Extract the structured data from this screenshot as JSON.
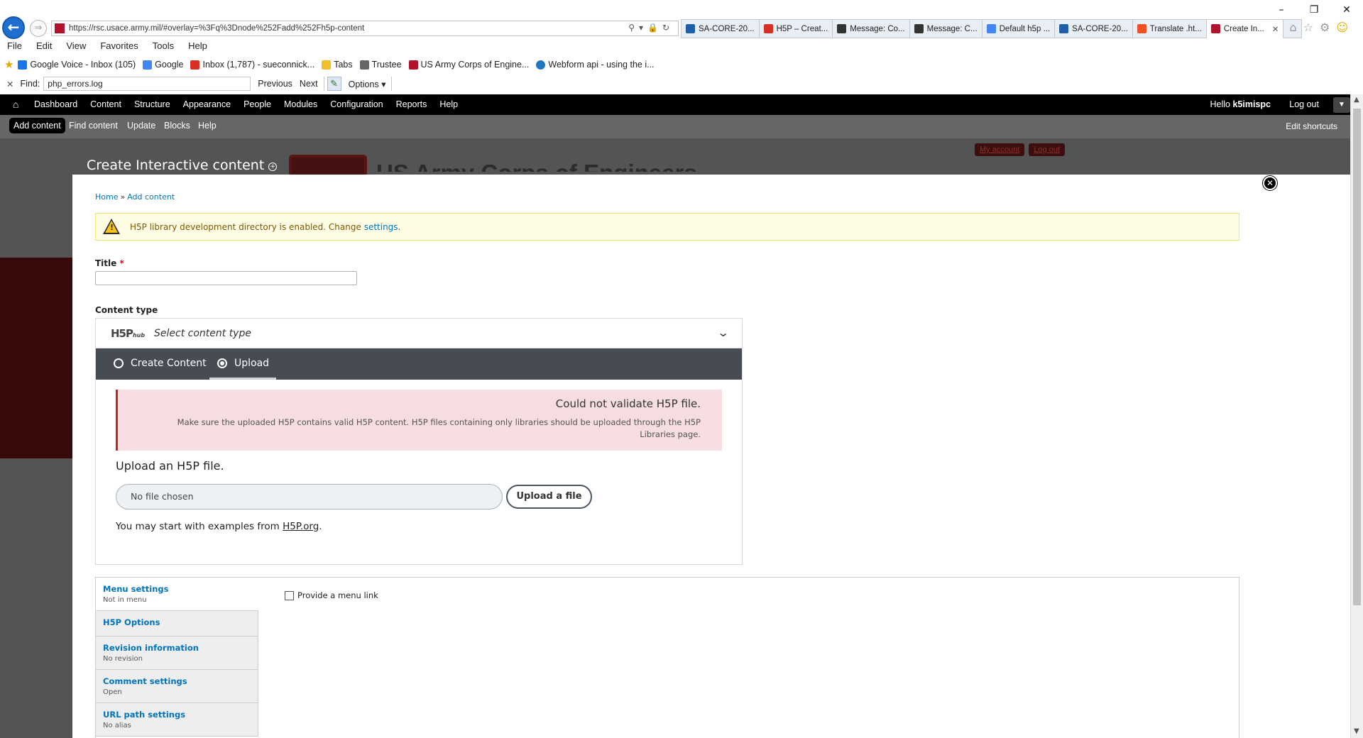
{
  "browser": {
    "url": "https://rsc.usace.army.mil/#overlay=%3Fq%3Dnode%252Fadd%252Fh5p-content",
    "tabs": [
      {
        "label": "SA-CORE-20...",
        "color": "#1f5fa8"
      },
      {
        "label": "H5P – Creat...",
        "color": "#d93025"
      },
      {
        "label": "Message: Co...",
        "color": "#333333"
      },
      {
        "label": "Message: C...",
        "color": "#333333"
      },
      {
        "label": "Default h5p ...",
        "color": "#4285f4"
      },
      {
        "label": "SA-CORE-20...",
        "color": "#1f5fa8"
      },
      {
        "label": "Translate .ht...",
        "color": "#f25022"
      },
      {
        "label": "Create In...",
        "color": "#b0132b"
      }
    ],
    "menu": [
      "File",
      "Edit",
      "View",
      "Favorites",
      "Tools",
      "Help"
    ],
    "favorites": [
      {
        "label": "Google Voice - Inbox (105)",
        "color": "#1a73e8"
      },
      {
        "label": "Google",
        "color": "#4285f4"
      },
      {
        "label": "Inbox (1,787) - sueconnick...",
        "color": "#d93025"
      },
      {
        "label": "Tabs",
        "color": "#f0c02a"
      },
      {
        "label": "Trustee",
        "color": "#666666"
      },
      {
        "label": "US Army Corps of Engine...",
        "color": "#b0132b"
      },
      {
        "label": "Webform api - using the i...",
        "color": "#1f78c1"
      }
    ],
    "find": {
      "label": "Find:",
      "value": "php_errors.log",
      "previous": "Previous",
      "next": "Next",
      "options": "Options"
    }
  },
  "toolbar": {
    "items": [
      "Dashboard",
      "Content",
      "Structure",
      "Appearance",
      "People",
      "Modules",
      "Configuration",
      "Reports",
      "Help"
    ],
    "hello": "Hello ",
    "username": "k5imispc",
    "logout": "Log out"
  },
  "shortcuts": {
    "items": [
      "Add content",
      "Find content",
      "Update",
      "Blocks",
      "Help"
    ],
    "edit": "Edit shortcuts"
  },
  "background_page": {
    "my_account": "My account",
    "log_out": "Log out",
    "banner": "US Army Corps of Engineers"
  },
  "overlay": {
    "title": "Create Interactive content",
    "breadcrumb": [
      "Home",
      "Add content"
    ],
    "warning_text": "H5P library development directory is enabled. Change ",
    "warning_link": "settings",
    "title_label": "Title",
    "content_type_label": "Content type"
  },
  "h5p": {
    "hub": "hub",
    "select_placeholder": "Select content type",
    "tab_create": "Create Content",
    "tab_upload": "Upload",
    "error_title": "Could not validate H5P file.",
    "error_body": "Make sure the uploaded H5P contains valid H5P content. H5P files containing only libraries should be uploaded through the H5P Libraries page.",
    "upload_heading": "Upload an H5P file.",
    "file_placeholder": "No file chosen",
    "upload_button": "Upload a file",
    "examples_prefix": "You may start with examples from ",
    "examples_link": "H5P.org",
    "examples_suffix": "."
  },
  "vertical_tabs": [
    {
      "title": "Menu settings",
      "summary": "Not in menu"
    },
    {
      "title": "H5P Options",
      "summary": ""
    },
    {
      "title": "Revision information",
      "summary": "No revision"
    },
    {
      "title": "Comment settings",
      "summary": "Open"
    },
    {
      "title": "URL path settings",
      "summary": "No alias"
    }
  ],
  "menu_link_label": "Provide a menu link"
}
